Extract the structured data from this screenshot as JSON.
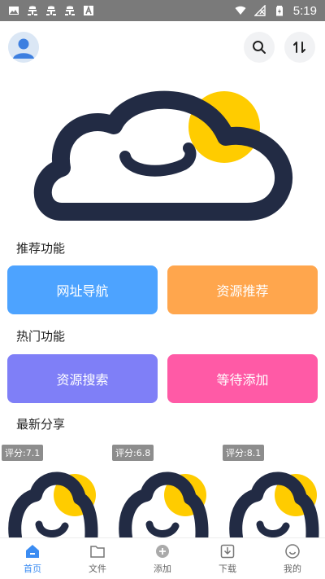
{
  "status_bar": {
    "time": "5:19",
    "left_icons": [
      "image-icon",
      "bug-icon",
      "bug-icon",
      "bug-icon",
      "a-box-icon"
    ],
    "right_icons": [
      "wifi-icon",
      "signal-off-icon",
      "battery-icon"
    ]
  },
  "header": {
    "avatar_icon": "user-avatar-icon",
    "search_icon": "search-icon",
    "sort_icon": "sort-icon"
  },
  "sections": {
    "recommend_title": "推荐功能",
    "hot_title": "热门功能",
    "latest_title": "最新分享"
  },
  "features": {
    "url_nav": "网址导航",
    "resource_recommend": "资源推荐",
    "resource_search": "资源搜索",
    "wait_add": "等待添加"
  },
  "colors": {
    "blue": "#4da3ff",
    "orange": "#ffa64d",
    "purple": "#7f7ff7",
    "pink": "#ff5aa6",
    "logo_dark": "#222b44",
    "logo_yellow": "#ffcc00",
    "active_nav": "#3b8cf2"
  },
  "shares": [
    {
      "rating": "评分:7.1"
    },
    {
      "rating": "评分:6.8"
    },
    {
      "rating": "评分:8.1"
    }
  ],
  "nav": {
    "home": "首页",
    "files": "文件",
    "add": "添加",
    "download": "下载",
    "mine": "我的"
  }
}
